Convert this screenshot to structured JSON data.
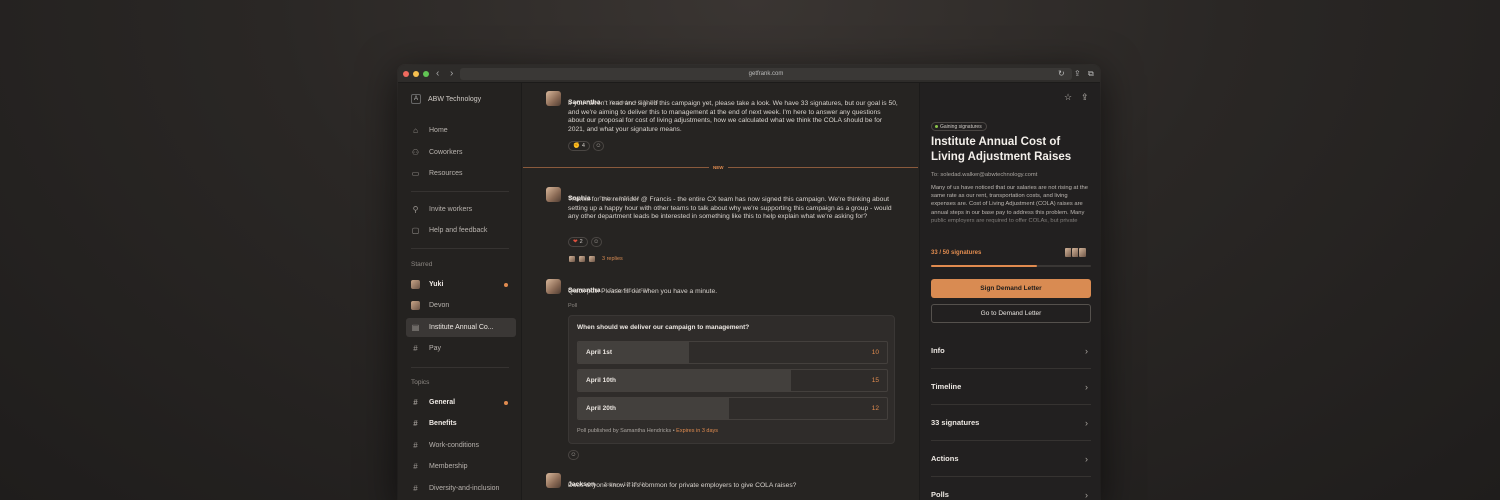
{
  "browser": {
    "url": "getfrank.com"
  },
  "sidebar": {
    "workspace_initial": "A",
    "workspace_name": "ABW Technology",
    "nav": [
      {
        "icon": "home-icon",
        "glyph": "⌂",
        "label": "Home"
      },
      {
        "icon": "coworkers-icon",
        "glyph": "⚇",
        "label": "Coworkers"
      },
      {
        "icon": "resources-icon",
        "glyph": "▭",
        "label": "Resources"
      }
    ],
    "actions": [
      {
        "icon": "invite-icon",
        "glyph": "⚲",
        "label": "Invite workers"
      },
      {
        "icon": "feedback-icon",
        "glyph": "▢",
        "label": "Help and feedback"
      }
    ],
    "starred_label": "Starred",
    "starred": [
      {
        "label": "Yuki"
      },
      {
        "label": "Devon"
      },
      {
        "label": "Institute Annual Co..."
      },
      {
        "label": "Pay"
      }
    ],
    "topics_label": "Topics",
    "topics": [
      {
        "label": "General"
      },
      {
        "label": "Benefits"
      },
      {
        "label": "Work-conditions"
      },
      {
        "label": "Membership"
      },
      {
        "label": "Diversity-and-inclusion"
      }
    ]
  },
  "feed": {
    "new_label": "NEW",
    "messages": [
      {
        "author": "Samantha",
        "time": "Yesterday • 8:11 PM",
        "body": "If you haven't read and signed this campaign yet, please take a look. We have 33 signatures, but our goal is 50, and we're aiming to deliver this to management at the end of next week. I'm here to answer any questions about our proposal for cost of living adjustments, how we calculated what we think the COLA should be for 2021, and what your signature means.",
        "reaction_emoji": "✊",
        "reaction_count": "4"
      },
      {
        "author": "Sophia",
        "time": "Today • 9:07 AM",
        "body": "Thanks for the reminder @ Francis - the entire CX team has now signed this campaign. We're thinking about setting up a happy hour with other teams to talk about why we're supporting this campaign as a group - would any other department leads be interested in something like this to help explain what we're asking for?",
        "reaction_emoji": "❤",
        "reaction_count": "2",
        "replies": "3 replies"
      },
      {
        "author": "Samantha",
        "time": "Today • 8:11 PM",
        "body": "Quick poll! Please fill out when you have a minute."
      },
      {
        "author": "Jackson",
        "time": "Today • 10:12 AM",
        "body": "Does anyone know if it's common for private employers to give COLA raises?"
      }
    ],
    "poll": {
      "label": "Poll",
      "question": "When should we deliver our campaign to management?",
      "options": [
        {
          "label": "April 1st",
          "count": "10",
          "fraction": 0.36
        },
        {
          "label": "April 10th",
          "count": "15",
          "fraction": 0.69
        },
        {
          "label": "April 20th",
          "count": "12",
          "fraction": 0.49
        }
      ],
      "footer": "Poll published by Samantha Hendricks • ",
      "expires": "Expires in 3 days"
    }
  },
  "panel": {
    "status": "Gaining signatures",
    "title": "Institute Annual Cost of Living Adjustment Raises",
    "to": "To: soledad.walker@abwtechnology.comt",
    "description": "Many of us have noticed that our salaries are not rising at the same rate as our rent, transportation costs, and living expenses are. Cost of Living Adjustment (COLA) raises are annual steps in our base pay to address this problem. Many public employers are required to offer COLAs, but private",
    "signatures": "33 / 50 signatures",
    "progress_fraction": 0.66,
    "sign_button": "Sign Demand Letter",
    "goto_button": "Go to Demand Letter",
    "sections": [
      "Info",
      "Timeline",
      "33 signatures",
      "Actions",
      "Polls"
    ]
  },
  "colors": {
    "accent": "#d98b52",
    "background": "#262422"
  }
}
